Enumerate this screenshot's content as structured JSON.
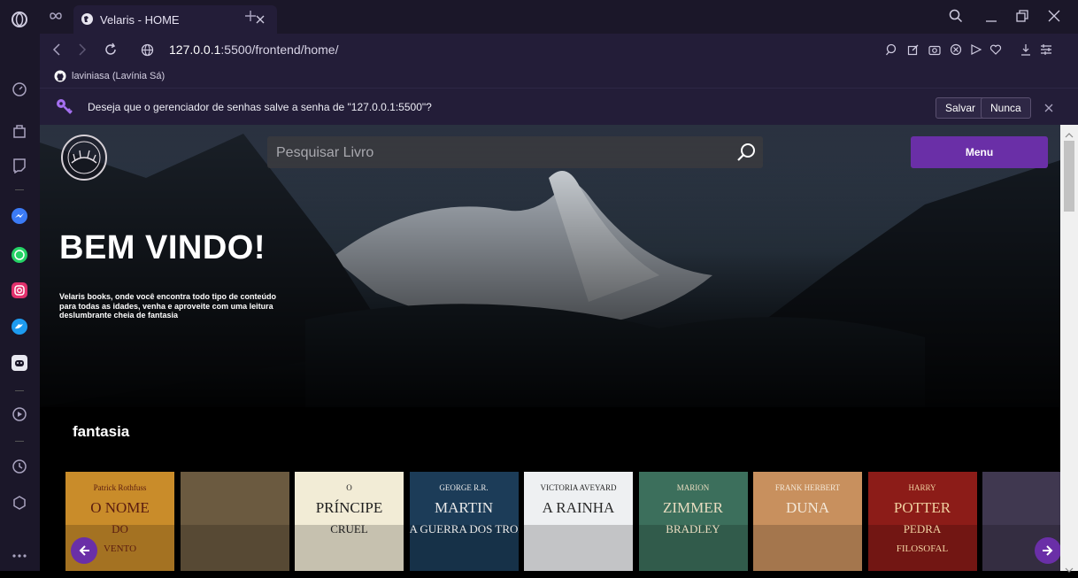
{
  "browser": {
    "tab_title": "Velaris - HOME",
    "url_host": "127.0.0.1",
    "url_path": ":5500/frontend/home/",
    "bookmark_label": "laviniasa (Lavínia Sá)"
  },
  "password_prompt": {
    "message": "Deseja que o gerenciador de senhas salve a senha de \"127.0.0.1:5500\"?",
    "save_label": "Salvar",
    "never_label": "Nunca"
  },
  "header": {
    "search_placeholder": "Pesquisar Livro",
    "menu_label": "Menu"
  },
  "hero": {
    "title": "BEM VINDO!",
    "tagline": "Velaris books, onde você encontra todo tipo de conteúdo para todas as idades, venha e aproveite com uma leitura deslumbrante cheia de fantasia"
  },
  "section": {
    "title": "fantasia"
  },
  "books": [
    {
      "name": "o-nome-do-vento",
      "t1": "Patrick Rothfuss",
      "t2": "O NOME",
      "t3": "DO",
      "t4": "VENTO",
      "bg": "#c98c2a",
      "fg": "#5a1c10"
    },
    {
      "name": "senhor-dos-aneis",
      "t1": "",
      "t2": "",
      "t3": "",
      "t4": "",
      "bg": "#6b5a40",
      "fg": "#ffffff"
    },
    {
      "name": "o-principe-cruel",
      "t1": "O",
      "t2": "PRÍNCIPE",
      "t3": "CRUEL",
      "t4": "",
      "bg": "#f2ecd6",
      "fg": "#1e1e1e"
    },
    {
      "name": "a-guerra-dos-tronos",
      "t1": "GEORGE R.R.",
      "t2": "MARTIN",
      "t3": "A GUERRA DOS TRONOS",
      "t4": "",
      "bg": "#1c3c58",
      "fg": "#e8e8e8"
    },
    {
      "name": "a-rainha-vermelha",
      "t1": "VICTORIA AVEYARD",
      "t2": "A RAINHA",
      "t3": "",
      "t4": "",
      "bg": "#eef0f2",
      "fg": "#2a2a2a"
    },
    {
      "name": "as-brumas-de-avalon",
      "t1": "MARION",
      "t2": "ZIMMER",
      "t3": "BRADLEY",
      "t4": "",
      "bg": "#3c6f5c",
      "fg": "#e8dcc0"
    },
    {
      "name": "duna",
      "t1": "FRANK HERBERT",
      "t2": "DUNA",
      "t3": "",
      "t4": "",
      "bg": "#c8905e",
      "fg": "#f4e8d8"
    },
    {
      "name": "harry-potter",
      "t1": "HARRY",
      "t2": "POTTER",
      "t3": "PEDRA",
      "t4": "FILOSOFAL",
      "bg": "#8c1c18",
      "fg": "#f0d0a0"
    },
    {
      "name": "livro-9",
      "t1": "",
      "t2": "",
      "t3": "",
      "t4": "",
      "bg": "#403850",
      "fg": "#ffffff"
    }
  ],
  "colors": {
    "accent": "#6a2fa7",
    "browser_bg": "#1b1729",
    "toolbar_bg": "#231d38"
  }
}
